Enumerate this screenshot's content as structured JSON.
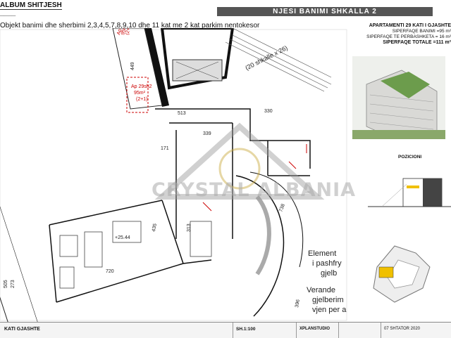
{
  "header": {
    "album_label": "ALBUM SHITJESH",
    "title": "NJESI BANIMI  SHKALLA 2",
    "subtitle": "Objekt banimi dhe sherbimi 2,3,4,5,7,8,9,10 dhe 11 kat me 2 kat parkim nentokesor"
  },
  "info": {
    "heading": "APARTAMENTI 29 KATI I GJASHTE",
    "line1": "SIPERFAQE BANIMI =95 m²",
    "line2": "SIPERFAQE TE PERBASHKETA = 16 m²",
    "line3": "SIPERFAQE TOTALE =111 m²"
  },
  "pozicion": "POZICIONI",
  "watermark": "CRYSTAL ALBANIA",
  "plan": {
    "apt_label1": "Ap 29sh2",
    "apt_area1": "95m²",
    "apt_type1": "(2+1)",
    "apt_label2": "Ap 29sh2",
    "apt_area2": "95m²",
    "apt_type2": "(2+1)",
    "stairs": "(20 shkalle x 26)",
    "dim_513": "513",
    "dim_330": "330",
    "dim_339": "339",
    "dim_171": "171",
    "dim_720": "720",
    "dim_435": "435",
    "dim_313": "313",
    "dim_738": "738",
    "dim_396": "396",
    "dim_505": "505",
    "dim_273": "273",
    "dim_449": "449",
    "elev": "+25.44",
    "element_text1": "Element",
    "element_text2": "i pashfry",
    "element_text3": "gjelb",
    "verande1": "Verande",
    "verande2": "gjelberim",
    "verande3": "vjen per a"
  },
  "footer": {
    "left": "KATI GJASHTE",
    "scale": "SH.1:100",
    "studio": "XPLANSTUDIO",
    "date": "07 SHTATOR 2020"
  }
}
